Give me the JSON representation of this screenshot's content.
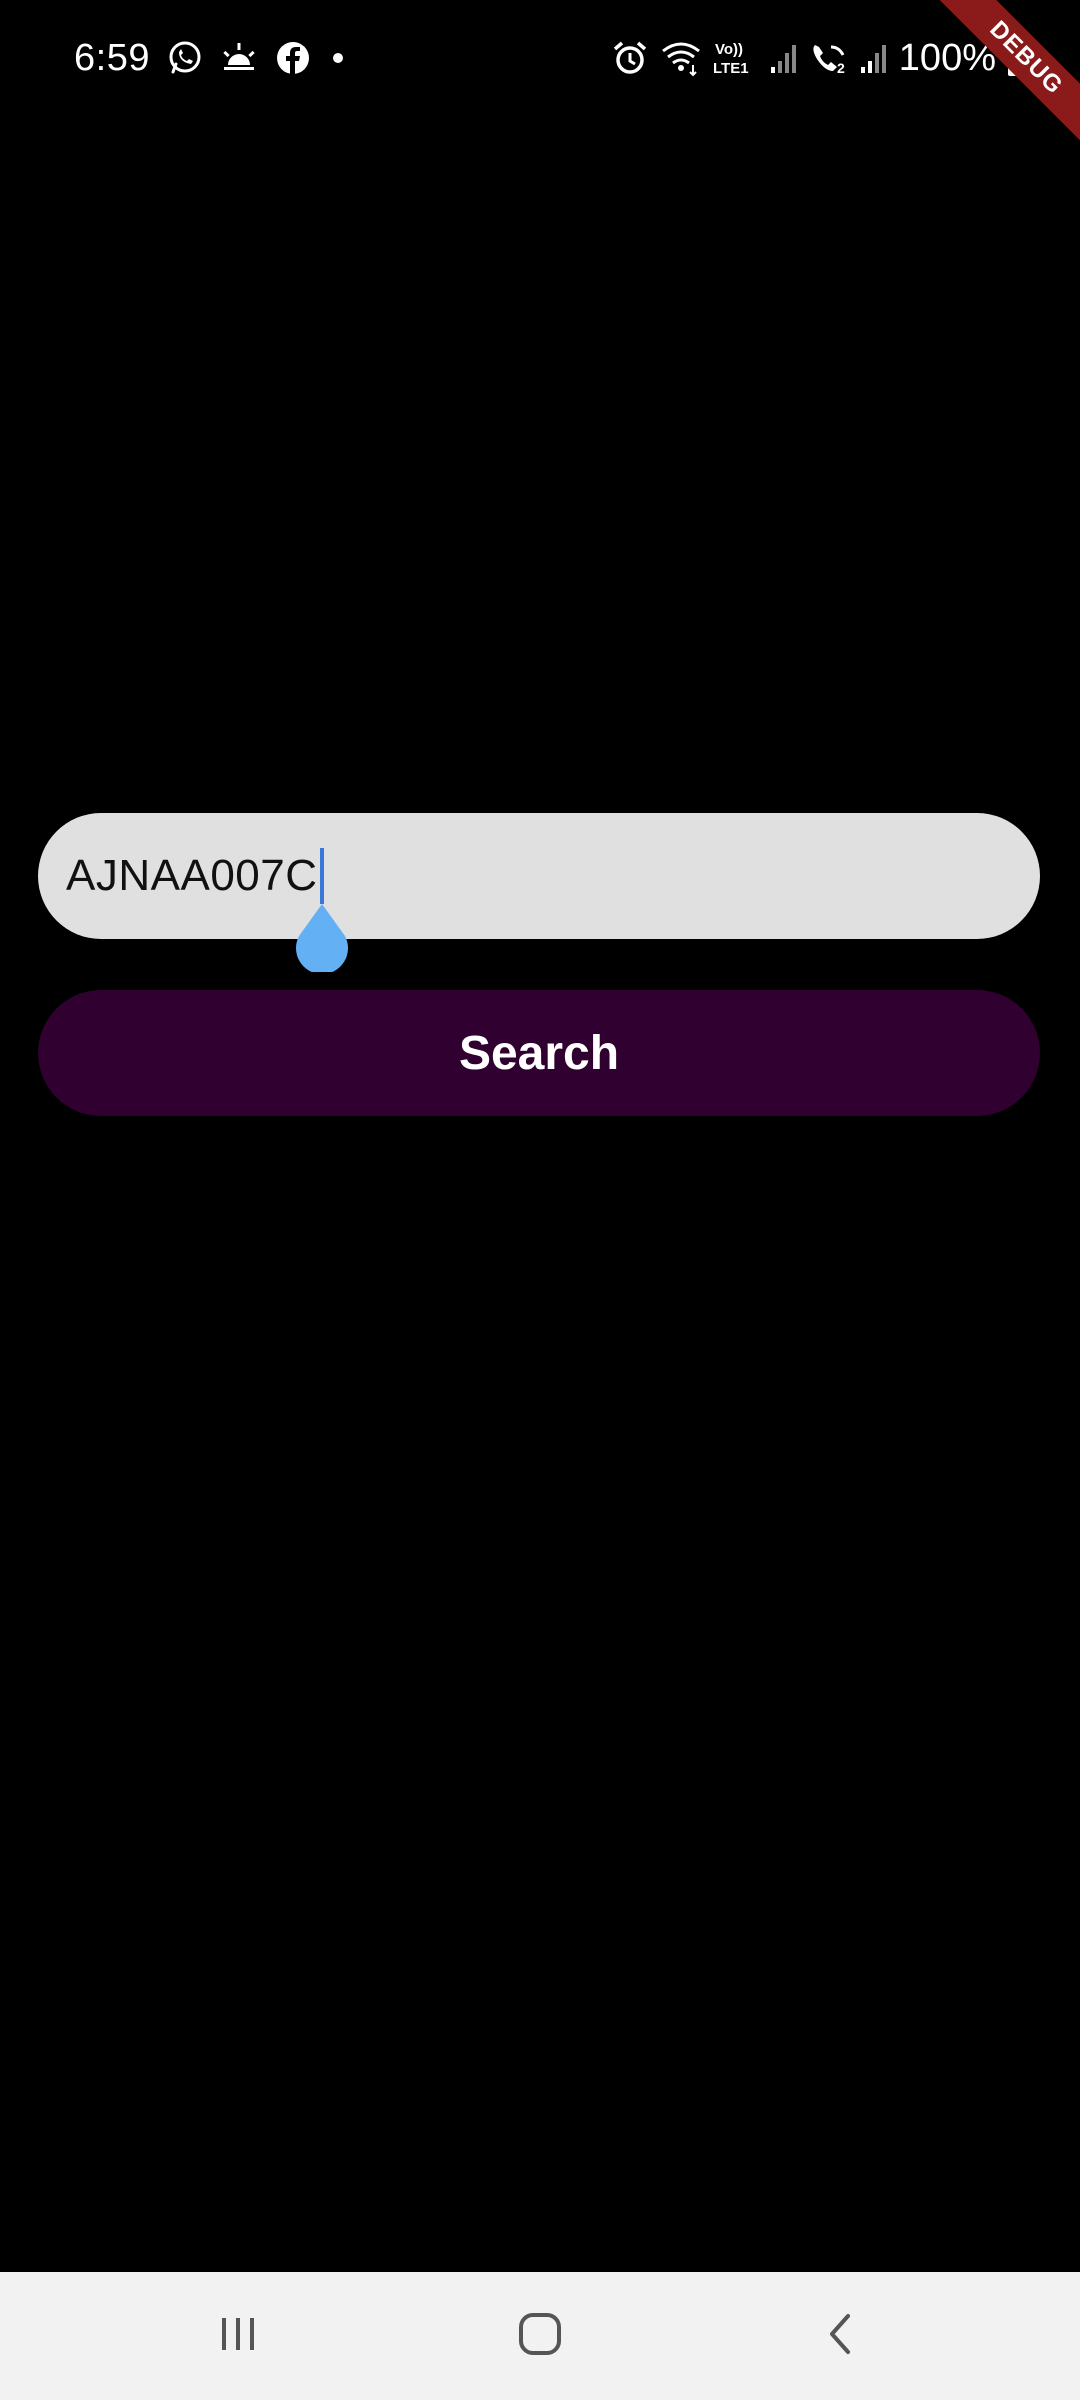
{
  "status_bar": {
    "time": "6:59",
    "left_icons": [
      "whatsapp-icon",
      "sunrise-icon",
      "facebook-icon",
      "notification-dot-icon"
    ],
    "right_icons": [
      "alarm-icon",
      "wifi-icon",
      "volte-lte1-icon",
      "signal-icon",
      "wifi-calling-icon",
      "signal-2-icon"
    ],
    "volte_label": "Vo))",
    "lte_label": "LTE1",
    "battery_percent": "100%",
    "debug_banner": "DEBUG"
  },
  "search": {
    "input_value": "AJNAA007C",
    "button_label": "Search"
  },
  "nav_bar": {
    "items": [
      "recents-icon",
      "home-icon",
      "back-icon"
    ]
  },
  "colors": {
    "background": "#000000",
    "input_background": "#e0e0e0",
    "button_background": "#300030",
    "cursor": "#3a78d8",
    "cursor_handle": "#64b0f4",
    "debug_ribbon": "#8b1a1a",
    "nav_background": "#f2f2f2"
  }
}
